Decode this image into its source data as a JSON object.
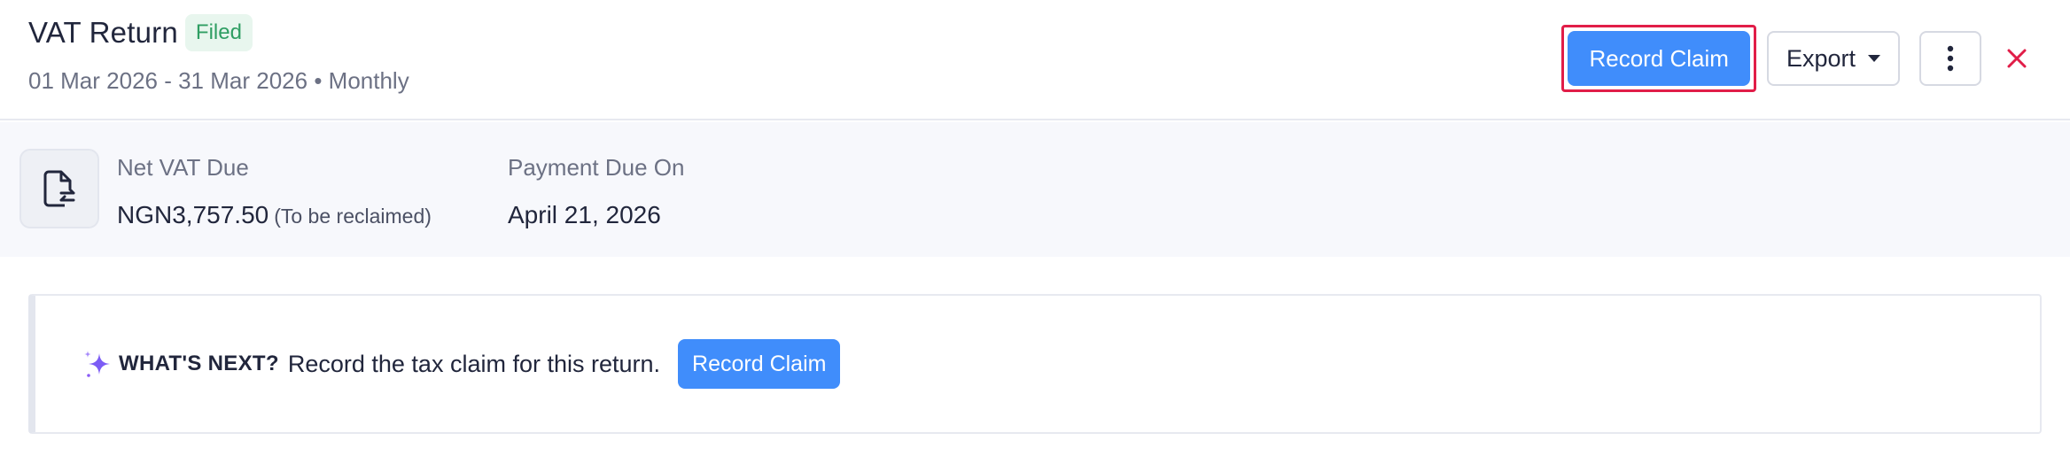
{
  "header": {
    "title": "VAT Return",
    "status_badge": "Filed",
    "period": "01 Mar 2026 - 31 Mar 2026",
    "separator": "•",
    "frequency": "Monthly",
    "record_claim_label": "Record Claim",
    "export_label": "Export"
  },
  "summary": {
    "net_vat_label": "Net VAT Due",
    "net_vat_value": "NGN3,757.50",
    "net_vat_note": "(To be reclaimed)",
    "payment_due_label": "Payment Due On",
    "payment_due_value": "April 21, 2026"
  },
  "whats_next": {
    "label": "WHAT'S NEXT?",
    "text": "Record the tax claim for this return.",
    "button_label": "Record Claim"
  },
  "colors": {
    "primary": "#408dfb",
    "badge_bg": "#e8f6ee",
    "badge_text": "#2f9e63",
    "close": "#e11d48",
    "highlight_border": "#e11d48"
  },
  "icons": [
    "caret-down-icon",
    "kebab-menu-icon",
    "close-icon",
    "document-exchange-icon",
    "sparkle-icon"
  ]
}
